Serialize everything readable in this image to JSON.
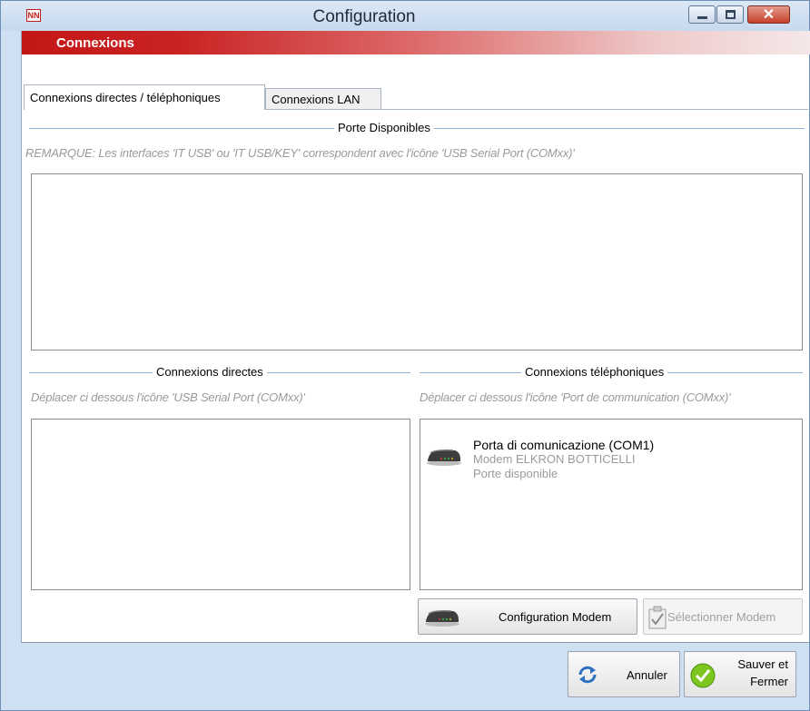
{
  "window": {
    "title": "Configuration",
    "app_icon_text": "NN",
    "controls": {
      "minimize": "minimize",
      "maximize": "maximize",
      "close": "✕"
    }
  },
  "header": {
    "title": "Connexions"
  },
  "tabs": [
    {
      "label": "Connexions directes / téléphoniques",
      "active": true
    },
    {
      "label": "Connexions LAN",
      "active": false
    }
  ],
  "ports_available": {
    "title": "Porte Disponibles",
    "note": "REMARQUE: Les interfaces 'IT USB' ou 'IT USB/KEY' correspondent avec l'icône 'USB Serial Port (COMxx)'",
    "items": []
  },
  "direct": {
    "title": "Connexions directes",
    "hint": "Déplacer ci dessous l'icône 'USB Serial Port (COMxx)'",
    "items": []
  },
  "phone": {
    "title": "Connexions téléphoniques",
    "hint": "Déplacer ci dessous l'icône 'Port de communication (COMxx)'",
    "items": [
      {
        "name": "Porta di comunicazione (COM1)",
        "modem": "Modem ELKRON BOTTICELLI",
        "status": "Porte disponible",
        "icon": "modem-icon"
      }
    ]
  },
  "buttons": {
    "configure_modem": "Configuration Modem",
    "select_modem": "Sélectionner Modem",
    "cancel": "Annuler",
    "save_line1": "Sauver et",
    "save_line2": "Fermer"
  },
  "colors": {
    "accent_red": "#c31717",
    "frame_blue": "#cfe0f2",
    "group_line": "#8fb0d6",
    "hint_gray": "#9a9a9a"
  }
}
